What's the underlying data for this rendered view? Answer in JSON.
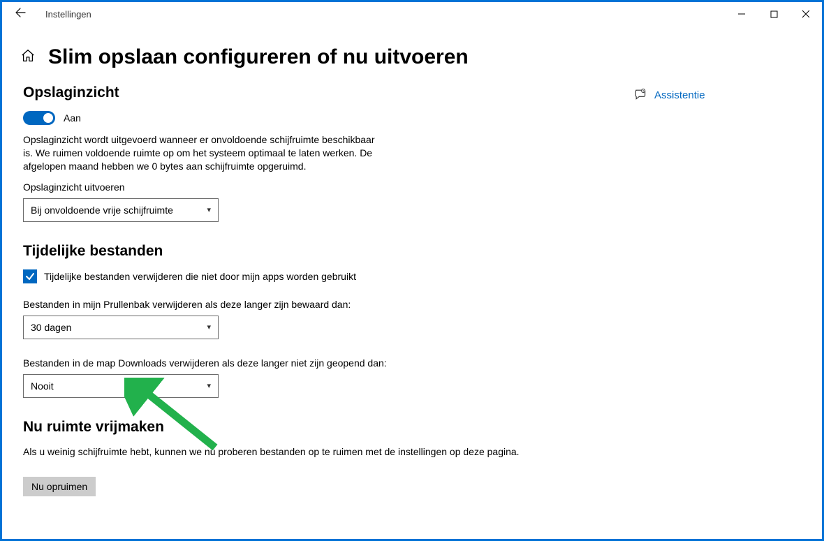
{
  "window": {
    "app_title": "Instellingen"
  },
  "page": {
    "title": "Slim opslaan configureren of nu uitvoeren"
  },
  "assist": {
    "label": "Assistentie"
  },
  "storage_sense": {
    "heading": "Opslaginzicht",
    "toggle_state_label": "Aan",
    "desc": "Opslaginzicht wordt uitgevoerd wanneer er onvoldoende schijfruimte beschikbaar is. We ruimen voldoende ruimte op om het systeem optimaal te laten werken. De afgelopen maand hebben we 0 bytes aan schijfruimte opgeruimd.",
    "run_label": "Opslaginzicht uitvoeren",
    "run_value": "Bij onvoldoende vrije schijfruimte"
  },
  "temp_files": {
    "heading": "Tijdelijke bestanden",
    "checkbox_label": "Tijdelijke bestanden verwijderen die niet door mijn apps worden gebruikt",
    "recycle_label": "Bestanden in mijn Prullenbak verwijderen als deze langer zijn bewaard dan:",
    "recycle_value": "30 dagen",
    "downloads_label": "Bestanden in de map Downloads verwijderen als deze langer niet zijn geopend dan:",
    "downloads_value": "Nooit"
  },
  "free_now": {
    "heading": "Nu ruimte vrijmaken",
    "desc": "Als u weinig schijfruimte hebt, kunnen we nu proberen bestanden op te ruimen met de instellingen op deze pagina.",
    "button": "Nu opruimen"
  }
}
